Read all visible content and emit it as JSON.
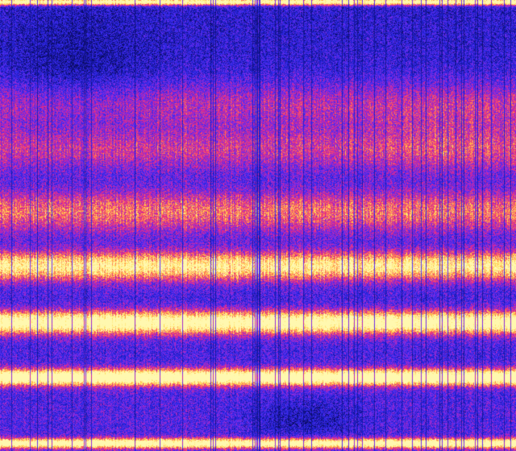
{
  "image": {
    "kind": "spectrogram",
    "palette": [
      "#0b0b5e",
      "#1e1ec8",
      "#3c2cf0",
      "#8a2be2",
      "#e0248a",
      "#ff6a5a",
      "#ffd84a",
      "#fff8b0"
    ],
    "noise": "heavy"
  }
}
